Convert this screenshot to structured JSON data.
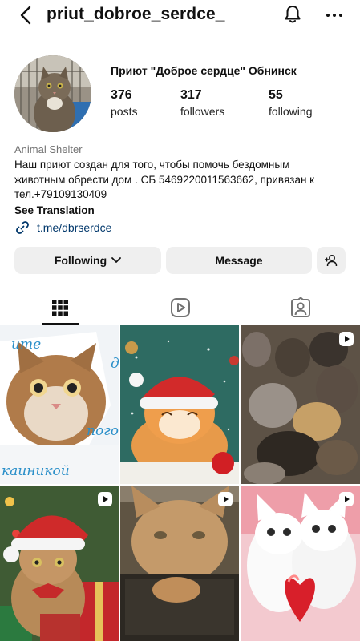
{
  "header": {
    "username": "priut_dobroe_serdce_",
    "icons": {
      "back": "chevron-left-icon",
      "notifications": "bell-icon",
      "more": "more-horizontal-icon"
    }
  },
  "profile": {
    "display_name": "Приют \"Доброе сердце\" Обнинск",
    "stats": {
      "posts": {
        "value": "376",
        "label": "posts"
      },
      "followers": {
        "value": "317",
        "label": "followers"
      },
      "following": {
        "value": "55",
        "label": "following"
      }
    },
    "category": "Animal Shelter",
    "bio": "Наш приют создан для того, чтобы помочь бездомным животным обрести дом . СБ 5469220011563662, привязан к тел.+79109130409",
    "see_translation": "See Translation",
    "link": "t.me/dbrserdce"
  },
  "actions": {
    "following_label": "Following",
    "message_label": "Message"
  },
  "tabs": {
    "items": [
      "posts-grid",
      "reels",
      "tagged"
    ],
    "active": "posts-grid"
  },
  "grid": {
    "tiles": [
      {
        "caption": "",
        "texts": [
          "ите",
          "д",
          "пого",
          "каиникой"
        ],
        "reel": false
      },
      {
        "caption": "",
        "texts": [],
        "reel": false
      },
      {
        "caption": "",
        "texts": [],
        "reel": true
      },
      {
        "caption": "",
        "texts": [],
        "reel": true
      },
      {
        "caption": "",
        "texts": [],
        "reel": true
      },
      {
        "caption": "",
        "texts": [],
        "reel": true
      }
    ]
  },
  "colors": {
    "text": "#111111",
    "muted": "#737373",
    "link": "#00376b",
    "button_bg": "#efefef"
  }
}
